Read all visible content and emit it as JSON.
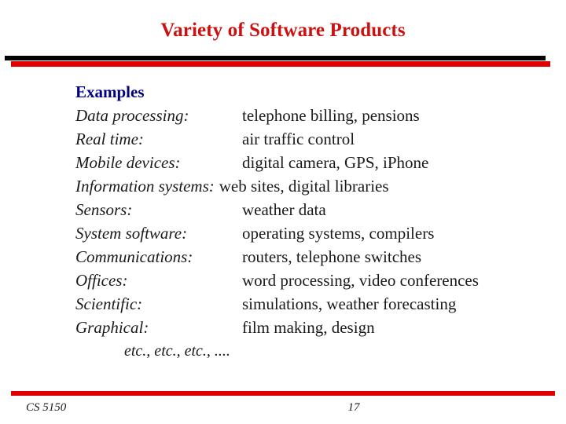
{
  "slide": {
    "title": "Variety of Software Products",
    "heading": "Examples",
    "etc_line": "etc., etc., etc., ....",
    "rows": [
      {
        "label": "Data processing:",
        "value": "telephone billing, pensions"
      },
      {
        "label": "Real time:",
        "value": "air traffic control"
      },
      {
        "label": "Mobile devices:",
        "value": "digital camera, GPS, iPhone"
      },
      {
        "label": "Information systems:",
        "value": "web sites, digital libraries"
      },
      {
        "label": "Sensors:",
        "value": "weather data"
      },
      {
        "label": "System software:",
        "value": "operating systems, compilers"
      },
      {
        "label": "Communications:",
        "value": "routers, telephone switches"
      },
      {
        "label": "Offices:",
        "value": "word processing, video conferences"
      },
      {
        "label": "Scientific:",
        "value": "simulations, weather forecasting"
      },
      {
        "label": "Graphical:",
        "value": "film making, design"
      }
    ]
  },
  "footer": {
    "course": "CS 5150",
    "page_number": "17"
  },
  "colors": {
    "title_red": "#cc1111",
    "rule_red": "#e00000",
    "rule_black": "#000000",
    "heading_navy": "#000080",
    "body_text": "#1a1a1a",
    "background": "#ffffff"
  }
}
